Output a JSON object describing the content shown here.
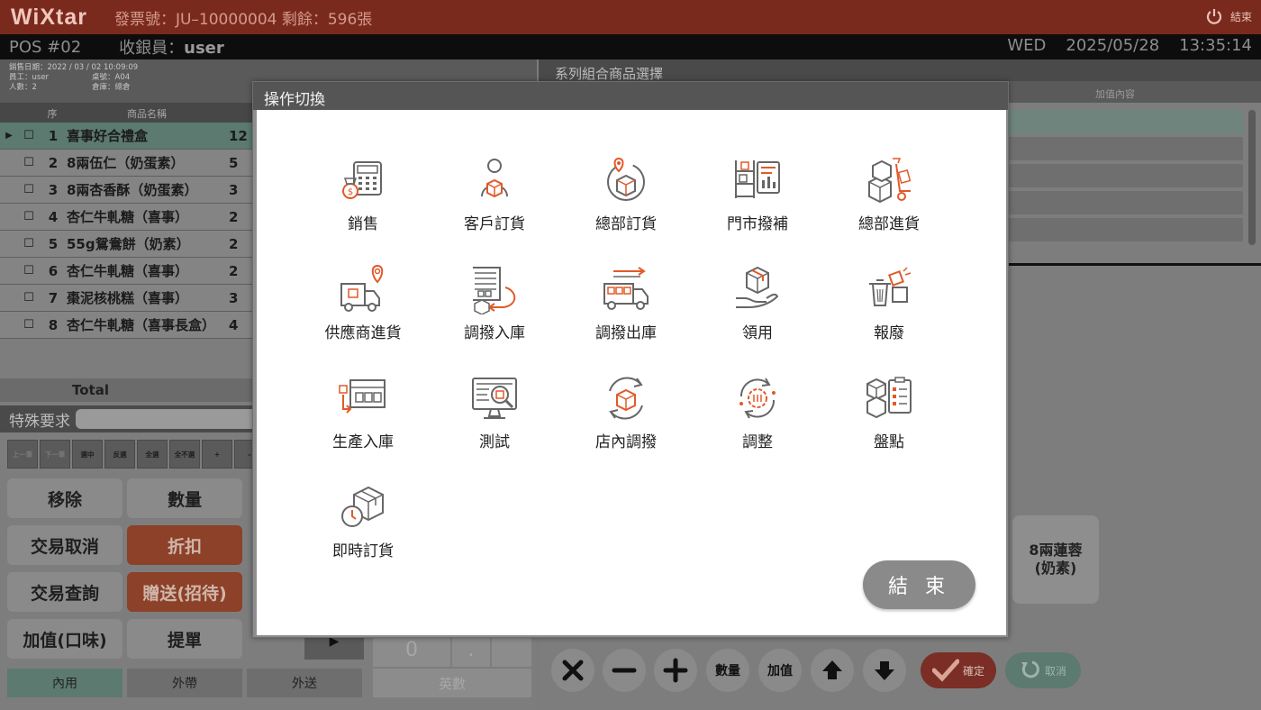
{
  "header": {
    "brand": "WiXtar",
    "invoice": "發票號：JU–10000004 剩餘：596張",
    "power_label": "結束"
  },
  "statusbar": {
    "pos": "POS #02",
    "cashier_label": "收銀員：",
    "cashier": "user",
    "weekday": "WED",
    "date": "2025/05/28",
    "time": "13:35:14"
  },
  "saleinfo": {
    "line1": "銷售日期：2022 / 03 / 02  10:09:09",
    "line2a": "員工：user",
    "line2b": "桌號：A04",
    "line3a": "人數：2",
    "line3b": "倉庫：總倉"
  },
  "grid": {
    "headers": {
      "seq": "序",
      "name": "商品名稱"
    },
    "rows": [
      {
        "no": "1",
        "name": "喜事好合禮盒",
        "qty": "12"
      },
      {
        "no": "2",
        "name": "8兩伍仁（奶蛋素）",
        "qty": "5"
      },
      {
        "no": "3",
        "name": "8兩杏香酥（奶蛋素）",
        "qty": "3"
      },
      {
        "no": "4",
        "name": "杏仁牛軋糖（喜事）",
        "qty": "2"
      },
      {
        "no": "5",
        "name": "55g鴛鴦餅（奶素）",
        "qty": "2"
      },
      {
        "no": "6",
        "name": "杏仁牛軋糖（喜事）",
        "qty": "2"
      },
      {
        "no": "7",
        "name": "棗泥核桃糕（喜事）",
        "qty": "3"
      },
      {
        "no": "8",
        "name": "杏仁牛軋糖（喜事長盒）",
        "qty": "4"
      }
    ],
    "checkbox_glyph": "☐",
    "row_arrow": "▶",
    "total_label": "Total"
  },
  "special": {
    "label": "特殊要求"
  },
  "minitools": [
    "上一筆",
    "下一筆",
    "選中",
    "反選",
    "全選",
    "全不選",
    "+",
    "–"
  ],
  "buttons": {
    "remove": "移除",
    "quantity": "數量",
    "cancel_txn": "交易取消",
    "discount": "折扣",
    "query_txn": "交易查詢",
    "gift": "贈送(招待)",
    "flavor": "加值(口味)",
    "pickup": "提單"
  },
  "modes": [
    "內用",
    "外帶",
    "外送"
  ],
  "numpad": {
    "zero": "0",
    "dot": ".",
    "alpha": "英數"
  },
  "rightpanel": {
    "title": "系列組合商品選擇",
    "col_addon": "加值內容",
    "product_card": "8兩蓮蓉\n(奶素)",
    "ctl_qty": "數量",
    "ctl_addon": "加值",
    "confirm": "確定",
    "cancel": "取消"
  },
  "modal": {
    "title": "操作切換",
    "items": [
      {
        "label": "銷售",
        "icon": "cash-register-icon"
      },
      {
        "label": "客戶訂貨",
        "icon": "customer-order-icon"
      },
      {
        "label": "總部訂貨",
        "icon": "hq-order-icon"
      },
      {
        "label": "門市撥補",
        "icon": "store-replenish-icon"
      },
      {
        "label": "總部進貨",
        "icon": "hq-purchase-icon"
      },
      {
        "label": "供應商進貨",
        "icon": "supplier-delivery-icon"
      },
      {
        "label": "調撥入庫",
        "icon": "transfer-in-icon"
      },
      {
        "label": "調撥出庫",
        "icon": "transfer-out-icon"
      },
      {
        "label": "領用",
        "icon": "requisition-icon"
      },
      {
        "label": "報廢",
        "icon": "scrap-icon"
      },
      {
        "label": "生產入庫",
        "icon": "production-in-icon"
      },
      {
        "label": "測試",
        "icon": "test-icon"
      },
      {
        "label": "店內調撥",
        "icon": "in-store-transfer-icon"
      },
      {
        "label": "調整",
        "icon": "adjust-icon"
      },
      {
        "label": "盤點",
        "icon": "stocktake-icon"
      },
      {
        "label": "即時訂貨",
        "icon": "instant-order-icon"
      }
    ],
    "close": "結 束"
  },
  "colors": {
    "topbar": "#7a2a1c",
    "accent_orange": "#e15a2a",
    "icon_gray": "#666666",
    "selected_green": "#5c7a6f"
  }
}
